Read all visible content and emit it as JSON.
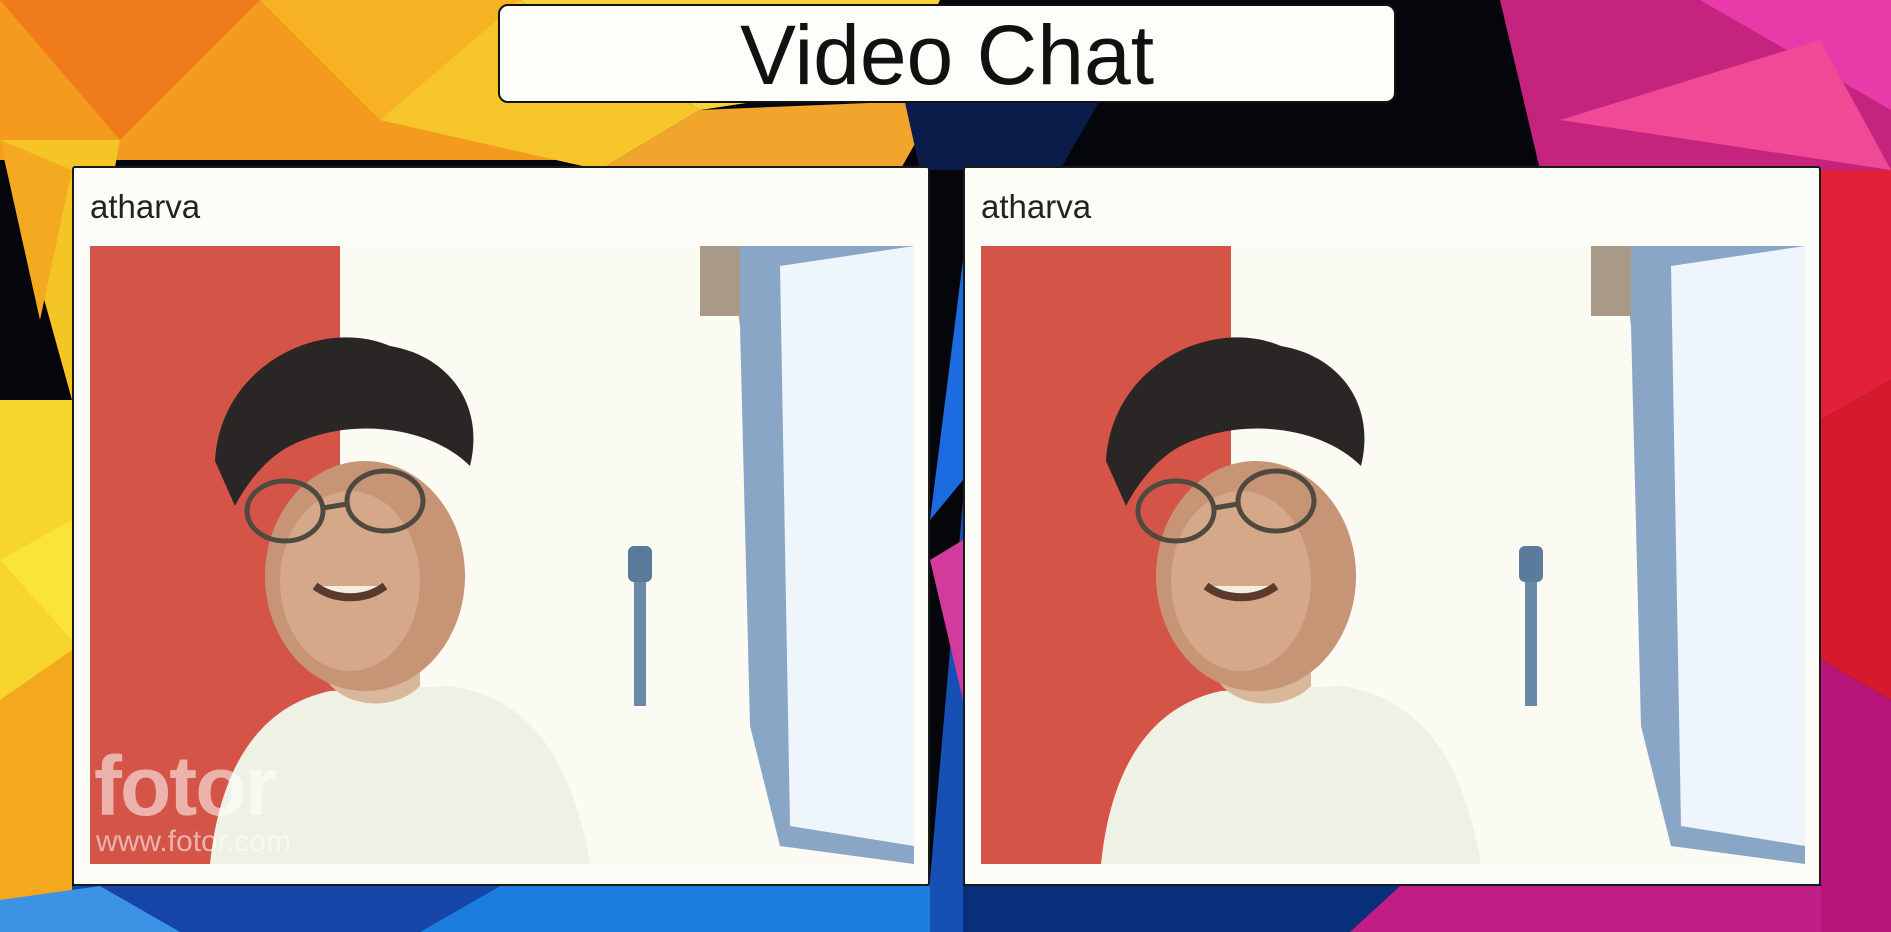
{
  "app": {
    "title": "Video Chat"
  },
  "panels": [
    {
      "participant_name": "atharva",
      "watermark": {
        "logo": "fotor",
        "url": "www.fotor.com"
      }
    },
    {
      "participant_name": "atharva"
    }
  ],
  "colors": {
    "panel_background": "#fdfdf8",
    "title_background": "#fdfdf9",
    "text": "#222222",
    "wall_red": "#d9574a"
  }
}
